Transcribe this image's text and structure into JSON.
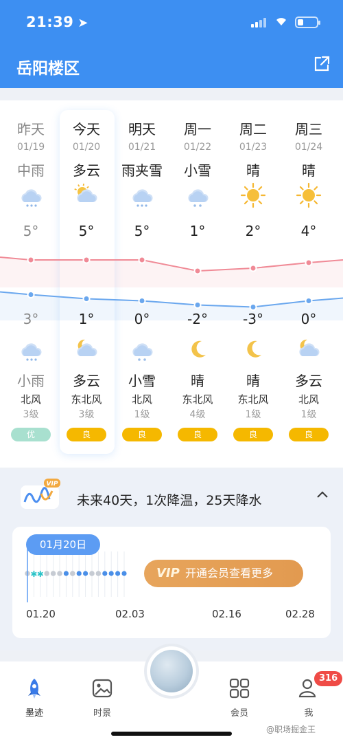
{
  "status": {
    "time": "21:39"
  },
  "header": {
    "location": "岳阳楼区",
    "share_icon": "share-icon"
  },
  "forecast": {
    "days": [
      {
        "name": "昨天",
        "date": "01/19",
        "day_cond": "中雨",
        "day_icon": "cloud-rain-icon",
        "high": "5°",
        "low": "3°",
        "night_icon": "cloud-rain-icon",
        "night_cond": "小雨",
        "wind_dir": "北风",
        "wind_level": "3级",
        "aqi": "优",
        "aqi_color": "#a8e0cf",
        "past": true
      },
      {
        "name": "今天",
        "date": "01/20",
        "day_cond": "多云",
        "day_icon": "partly-cloudy-icon",
        "high": "5°",
        "low": "1°",
        "night_icon": "moon-cloud-icon",
        "night_cond": "多云",
        "wind_dir": "东北风",
        "wind_level": "3级",
        "aqi": "良",
        "aqi_color": "#f5b800",
        "today": true
      },
      {
        "name": "明天",
        "date": "01/21",
        "day_cond": "雨夹雪",
        "day_icon": "sleet-icon",
        "high": "5°",
        "low": "0°",
        "night_icon": "snow-cloud-icon",
        "night_cond": "小雪",
        "wind_dir": "北风",
        "wind_level": "1级",
        "aqi": "良",
        "aqi_color": "#f5b800"
      },
      {
        "name": "周一",
        "date": "01/22",
        "day_cond": "小雪",
        "day_icon": "snow-cloud-icon",
        "high": "1°",
        "low": "-2°",
        "night_icon": "moon-icon",
        "night_cond": "晴",
        "wind_dir": "东北风",
        "wind_level": "4级",
        "aqi": "良",
        "aqi_color": "#f5b800"
      },
      {
        "name": "周二",
        "date": "01/23",
        "day_cond": "晴",
        "day_icon": "sun-icon",
        "high": "2°",
        "low": "-3°",
        "night_icon": "moon-icon",
        "night_cond": "晴",
        "wind_dir": "东北风",
        "wind_level": "1级",
        "aqi": "良",
        "aqi_color": "#f5b800"
      },
      {
        "name": "周三",
        "date": "01/24",
        "day_cond": "晴",
        "day_icon": "sun-icon",
        "high": "4°",
        "low": "0°",
        "night_icon": "moon-cloud-icon",
        "night_cond": "多云",
        "wind_dir": "北风",
        "wind_level": "1级",
        "aqi": "良",
        "aqi_color": "#f5b800"
      }
    ],
    "highs": [
      5,
      5,
      5,
      1,
      2,
      4
    ],
    "lows": [
      3,
      1,
      0,
      -2,
      -3,
      0
    ]
  },
  "outlook": {
    "logo_icon": "vip-trend-icon",
    "summary": "未来40天，1次降温，25天降水",
    "date_pill": "01月20日",
    "vip_mark": "VIP",
    "vip_button": "开通会员查看更多",
    "ticks": [
      "01.20",
      "02.03",
      "02.16",
      "02.28"
    ]
  },
  "tabbar": {
    "tabs": [
      {
        "label": "墨迹",
        "icon": "rocket-icon",
        "active": true
      },
      {
        "label": "时景",
        "icon": "photo-icon"
      },
      {
        "label": "会员",
        "icon": "grid-icon"
      },
      {
        "label": "我",
        "icon": "profile-icon",
        "badge": "316"
      }
    ]
  },
  "watermark": "@职场掘金王",
  "colors": {
    "brand": "#3d8ff2",
    "high_line": "#f08a96",
    "low_line": "#6aa7ee",
    "aqi_good": "#f5b800"
  }
}
